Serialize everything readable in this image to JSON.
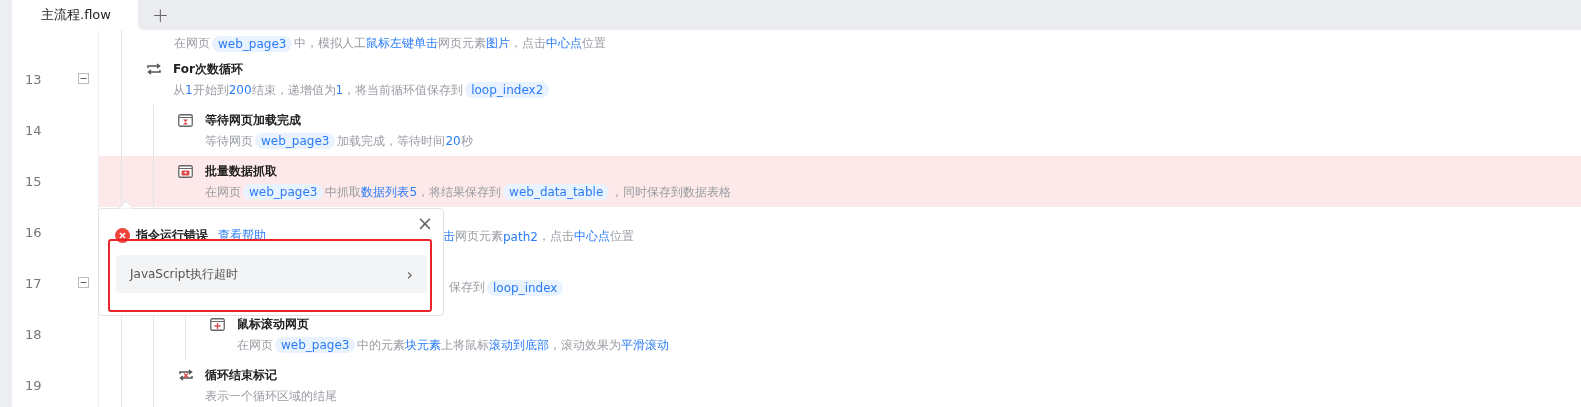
{
  "tabs": [
    {
      "label": "主流程.flow",
      "selected": true
    }
  ],
  "add_tab": "+",
  "steps": [
    {
      "kind": "none",
      "desc": [
        {
          "t": "在网页",
          "kind": "plain"
        },
        {
          "t": "web_page3",
          "kind": "var"
        },
        {
          "t": "中，模拟人工",
          "kind": "plain"
        },
        {
          "t": "鼠标左键单击",
          "kind": "link"
        },
        {
          "t": "网页元素",
          "kind": "plain"
        },
        {
          "t": "图片",
          "kind": "link"
        },
        {
          "t": "，点击",
          "kind": "plain"
        },
        {
          "t": "中心点",
          "kind": "link"
        },
        {
          "t": "位置",
          "kind": "plain"
        }
      ]
    },
    {
      "number": "13",
      "kind": "loop",
      "expanded": true,
      "title": "For次数循环",
      "desc": [
        {
          "t": "从",
          "kind": "plain"
        },
        {
          "t": "1",
          "kind": "link"
        },
        {
          "t": "开始到",
          "kind": "plain"
        },
        {
          "t": "200",
          "kind": "link"
        },
        {
          "t": "结束，递增值为",
          "kind": "plain"
        },
        {
          "t": "1",
          "kind": "link"
        },
        {
          "t": "，将当前循环值保存到",
          "kind": "plain"
        },
        {
          "t": "loop_index2",
          "kind": "var"
        }
      ],
      "children": [
        {
          "number": "14",
          "kind": "wait",
          "title": "等待网页加载完成",
          "desc": [
            {
              "t": "等待网页",
              "kind": "plain"
            },
            {
              "t": "web_page3",
              "kind": "var"
            },
            {
              "t": "加载完成，等待时间",
              "kind": "plain"
            },
            {
              "t": "20",
              "kind": "link"
            },
            {
              "t": "秒",
              "kind": "plain"
            }
          ]
        },
        {
          "number": "15",
          "kind": "grab",
          "error": true,
          "title": "批量数据抓取",
          "desc": [
            {
              "t": "在网页",
              "kind": "plain"
            },
            {
              "t": "web_page3",
              "kind": "var"
            },
            {
              "t": "中抓取",
              "kind": "plain"
            },
            {
              "t": "数据列表5",
              "kind": "link"
            },
            {
              "t": "，将结果保存到",
              "kind": "plain"
            },
            {
              "t": "web_data_table",
              "kind": "var"
            },
            {
              "t": "，同时保存到数据表格",
              "kind": "plain"
            }
          ]
        },
        {
          "number": "16",
          "kind": "covered",
          "desc": [
            {
              "t": "击",
              "kind": "link"
            },
            {
              "t": "网页元素",
              "kind": "plain"
            },
            {
              "t": "path2",
              "kind": "link"
            },
            {
              "t": "，点击",
              "kind": "plain"
            },
            {
              "t": "中心点",
              "kind": "link"
            },
            {
              "t": "位置",
              "kind": "plain"
            }
          ]
        },
        {
          "number": "17",
          "kind": "covered",
          "expanded": true,
          "desc": [
            {
              "t": "保存到",
              "kind": "plain"
            },
            {
              "t": "loop_index",
              "kind": "var"
            }
          ],
          "children": [
            {
              "number": "18",
              "kind": "scroll",
              "title": "鼠标滚动网页",
              "desc": [
                {
                  "t": "在网页",
                  "kind": "plain"
                },
                {
                  "t": "web_page3",
                  "kind": "var"
                },
                {
                  "t": "中的元素",
                  "kind": "plain"
                },
                {
                  "t": "块元素",
                  "kind": "link"
                },
                {
                  "t": "上将鼠标",
                  "kind": "plain"
                },
                {
                  "t": "滚动到底部",
                  "kind": "link"
                },
                {
                  "t": "，滚动效果为",
                  "kind": "plain"
                },
                {
                  "t": "平滑滚动",
                  "kind": "link"
                }
              ]
            }
          ]
        },
        {
          "number": "19",
          "kind": "loop-end",
          "title": "循环结束标记",
          "desc": [
            {
              "t": "表示一个循环区域的结尾",
              "kind": "plain"
            }
          ]
        }
      ]
    }
  ],
  "error_popup": {
    "title": "指令运行错误",
    "help_link": "查看帮助",
    "close": "×",
    "message": "JavaScript执行超时",
    "chevron": "›"
  }
}
